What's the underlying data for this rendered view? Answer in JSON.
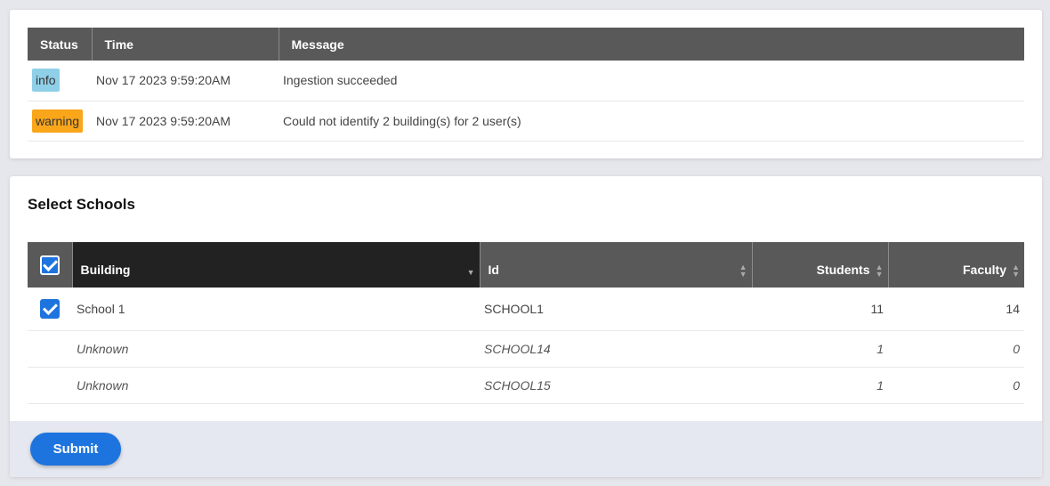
{
  "log": {
    "headers": {
      "status": "Status",
      "time": "Time",
      "message": "Message"
    },
    "rows": [
      {
        "status": "info",
        "time": "Nov 17 2023 9:59:20AM",
        "message": "Ingestion succeeded"
      },
      {
        "status": "warning",
        "time": "Nov 17 2023 9:59:20AM",
        "message": "Could not identify 2 building(s) for 2 user(s)"
      }
    ],
    "colors": {
      "info": "#8fd0e8",
      "warning": "#f9a61a",
      "header": "#595959"
    }
  },
  "schools": {
    "title": "Select Schools",
    "select_all_checked": true,
    "headers": {
      "building": "Building",
      "id": "Id",
      "students": "Students",
      "faculty": "Faculty"
    },
    "sorted_column": "building",
    "rows": [
      {
        "checked": true,
        "building": "School 1",
        "id": "SCHOOL1",
        "students": "11",
        "faculty": "14"
      },
      {
        "checked": false,
        "building": "Unknown",
        "id": "SCHOOL14",
        "students": "1",
        "faculty": "0"
      },
      {
        "checked": false,
        "building": "Unknown",
        "id": "SCHOOL15",
        "students": "1",
        "faculty": "0"
      }
    ]
  },
  "footer": {
    "submit_label": "Submit",
    "accent": "#1e74de"
  }
}
